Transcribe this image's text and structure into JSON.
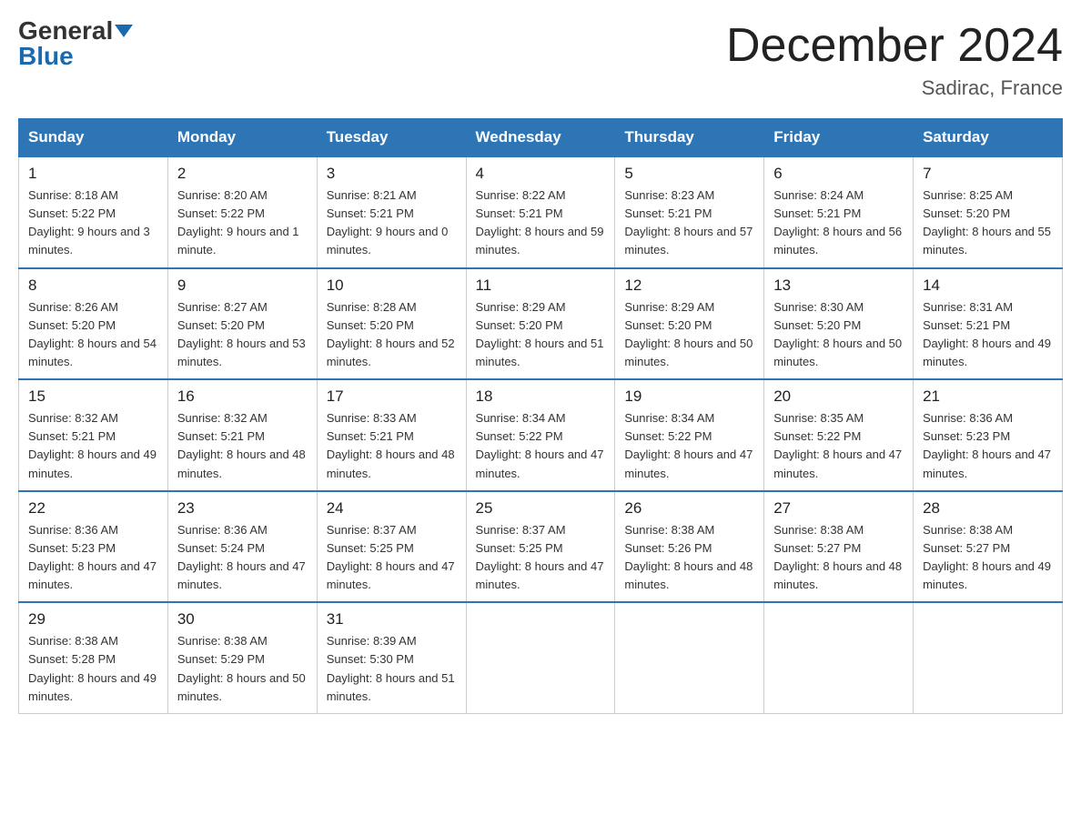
{
  "logo": {
    "general": "General",
    "blue": "Blue"
  },
  "title": "December 2024",
  "location": "Sadirac, France",
  "days_of_week": [
    "Sunday",
    "Monday",
    "Tuesday",
    "Wednesday",
    "Thursday",
    "Friday",
    "Saturday"
  ],
  "weeks": [
    [
      {
        "day": "1",
        "sunrise": "8:18 AM",
        "sunset": "5:22 PM",
        "daylight": "9 hours and 3 minutes."
      },
      {
        "day": "2",
        "sunrise": "8:20 AM",
        "sunset": "5:22 PM",
        "daylight": "9 hours and 1 minute."
      },
      {
        "day": "3",
        "sunrise": "8:21 AM",
        "sunset": "5:21 PM",
        "daylight": "9 hours and 0 minutes."
      },
      {
        "day": "4",
        "sunrise": "8:22 AM",
        "sunset": "5:21 PM",
        "daylight": "8 hours and 59 minutes."
      },
      {
        "day": "5",
        "sunrise": "8:23 AM",
        "sunset": "5:21 PM",
        "daylight": "8 hours and 57 minutes."
      },
      {
        "day": "6",
        "sunrise": "8:24 AM",
        "sunset": "5:21 PM",
        "daylight": "8 hours and 56 minutes."
      },
      {
        "day": "7",
        "sunrise": "8:25 AM",
        "sunset": "5:20 PM",
        "daylight": "8 hours and 55 minutes."
      }
    ],
    [
      {
        "day": "8",
        "sunrise": "8:26 AM",
        "sunset": "5:20 PM",
        "daylight": "8 hours and 54 minutes."
      },
      {
        "day": "9",
        "sunrise": "8:27 AM",
        "sunset": "5:20 PM",
        "daylight": "8 hours and 53 minutes."
      },
      {
        "day": "10",
        "sunrise": "8:28 AM",
        "sunset": "5:20 PM",
        "daylight": "8 hours and 52 minutes."
      },
      {
        "day": "11",
        "sunrise": "8:29 AM",
        "sunset": "5:20 PM",
        "daylight": "8 hours and 51 minutes."
      },
      {
        "day": "12",
        "sunrise": "8:29 AM",
        "sunset": "5:20 PM",
        "daylight": "8 hours and 50 minutes."
      },
      {
        "day": "13",
        "sunrise": "8:30 AM",
        "sunset": "5:20 PM",
        "daylight": "8 hours and 50 minutes."
      },
      {
        "day": "14",
        "sunrise": "8:31 AM",
        "sunset": "5:21 PM",
        "daylight": "8 hours and 49 minutes."
      }
    ],
    [
      {
        "day": "15",
        "sunrise": "8:32 AM",
        "sunset": "5:21 PM",
        "daylight": "8 hours and 49 minutes."
      },
      {
        "day": "16",
        "sunrise": "8:32 AM",
        "sunset": "5:21 PM",
        "daylight": "8 hours and 48 minutes."
      },
      {
        "day": "17",
        "sunrise": "8:33 AM",
        "sunset": "5:21 PM",
        "daylight": "8 hours and 48 minutes."
      },
      {
        "day": "18",
        "sunrise": "8:34 AM",
        "sunset": "5:22 PM",
        "daylight": "8 hours and 47 minutes."
      },
      {
        "day": "19",
        "sunrise": "8:34 AM",
        "sunset": "5:22 PM",
        "daylight": "8 hours and 47 minutes."
      },
      {
        "day": "20",
        "sunrise": "8:35 AM",
        "sunset": "5:22 PM",
        "daylight": "8 hours and 47 minutes."
      },
      {
        "day": "21",
        "sunrise": "8:36 AM",
        "sunset": "5:23 PM",
        "daylight": "8 hours and 47 minutes."
      }
    ],
    [
      {
        "day": "22",
        "sunrise": "8:36 AM",
        "sunset": "5:23 PM",
        "daylight": "8 hours and 47 minutes."
      },
      {
        "day": "23",
        "sunrise": "8:36 AM",
        "sunset": "5:24 PM",
        "daylight": "8 hours and 47 minutes."
      },
      {
        "day": "24",
        "sunrise": "8:37 AM",
        "sunset": "5:25 PM",
        "daylight": "8 hours and 47 minutes."
      },
      {
        "day": "25",
        "sunrise": "8:37 AM",
        "sunset": "5:25 PM",
        "daylight": "8 hours and 47 minutes."
      },
      {
        "day": "26",
        "sunrise": "8:38 AM",
        "sunset": "5:26 PM",
        "daylight": "8 hours and 48 minutes."
      },
      {
        "day": "27",
        "sunrise": "8:38 AM",
        "sunset": "5:27 PM",
        "daylight": "8 hours and 48 minutes."
      },
      {
        "day": "28",
        "sunrise": "8:38 AM",
        "sunset": "5:27 PM",
        "daylight": "8 hours and 49 minutes."
      }
    ],
    [
      {
        "day": "29",
        "sunrise": "8:38 AM",
        "sunset": "5:28 PM",
        "daylight": "8 hours and 49 minutes."
      },
      {
        "day": "30",
        "sunrise": "8:38 AM",
        "sunset": "5:29 PM",
        "daylight": "8 hours and 50 minutes."
      },
      {
        "day": "31",
        "sunrise": "8:39 AM",
        "sunset": "5:30 PM",
        "daylight": "8 hours and 51 minutes."
      },
      null,
      null,
      null,
      null
    ]
  ]
}
